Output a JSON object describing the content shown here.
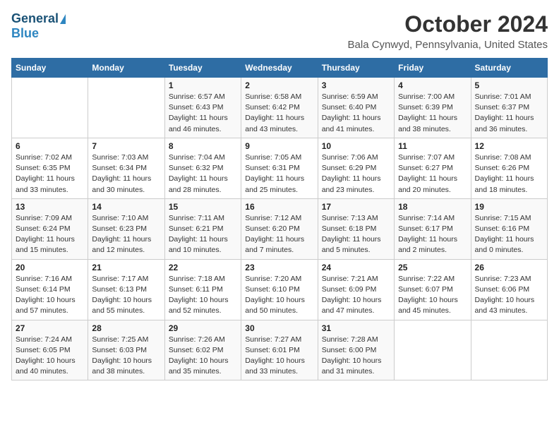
{
  "header": {
    "logo_general": "General",
    "logo_blue": "Blue",
    "month_title": "October 2024",
    "location": "Bala Cynwyd, Pennsylvania, United States"
  },
  "days_of_week": [
    "Sunday",
    "Monday",
    "Tuesday",
    "Wednesday",
    "Thursday",
    "Friday",
    "Saturday"
  ],
  "weeks": [
    [
      {
        "day": "",
        "info": ""
      },
      {
        "day": "",
        "info": ""
      },
      {
        "day": "1",
        "info": "Sunrise: 6:57 AM\nSunset: 6:43 PM\nDaylight: 11 hours and 46 minutes."
      },
      {
        "day": "2",
        "info": "Sunrise: 6:58 AM\nSunset: 6:42 PM\nDaylight: 11 hours and 43 minutes."
      },
      {
        "day": "3",
        "info": "Sunrise: 6:59 AM\nSunset: 6:40 PM\nDaylight: 11 hours and 41 minutes."
      },
      {
        "day": "4",
        "info": "Sunrise: 7:00 AM\nSunset: 6:39 PM\nDaylight: 11 hours and 38 minutes."
      },
      {
        "day": "5",
        "info": "Sunrise: 7:01 AM\nSunset: 6:37 PM\nDaylight: 11 hours and 36 minutes."
      }
    ],
    [
      {
        "day": "6",
        "info": "Sunrise: 7:02 AM\nSunset: 6:35 PM\nDaylight: 11 hours and 33 minutes."
      },
      {
        "day": "7",
        "info": "Sunrise: 7:03 AM\nSunset: 6:34 PM\nDaylight: 11 hours and 30 minutes."
      },
      {
        "day": "8",
        "info": "Sunrise: 7:04 AM\nSunset: 6:32 PM\nDaylight: 11 hours and 28 minutes."
      },
      {
        "day": "9",
        "info": "Sunrise: 7:05 AM\nSunset: 6:31 PM\nDaylight: 11 hours and 25 minutes."
      },
      {
        "day": "10",
        "info": "Sunrise: 7:06 AM\nSunset: 6:29 PM\nDaylight: 11 hours and 23 minutes."
      },
      {
        "day": "11",
        "info": "Sunrise: 7:07 AM\nSunset: 6:27 PM\nDaylight: 11 hours and 20 minutes."
      },
      {
        "day": "12",
        "info": "Sunrise: 7:08 AM\nSunset: 6:26 PM\nDaylight: 11 hours and 18 minutes."
      }
    ],
    [
      {
        "day": "13",
        "info": "Sunrise: 7:09 AM\nSunset: 6:24 PM\nDaylight: 11 hours and 15 minutes."
      },
      {
        "day": "14",
        "info": "Sunrise: 7:10 AM\nSunset: 6:23 PM\nDaylight: 11 hours and 12 minutes."
      },
      {
        "day": "15",
        "info": "Sunrise: 7:11 AM\nSunset: 6:21 PM\nDaylight: 11 hours and 10 minutes."
      },
      {
        "day": "16",
        "info": "Sunrise: 7:12 AM\nSunset: 6:20 PM\nDaylight: 11 hours and 7 minutes."
      },
      {
        "day": "17",
        "info": "Sunrise: 7:13 AM\nSunset: 6:18 PM\nDaylight: 11 hours and 5 minutes."
      },
      {
        "day": "18",
        "info": "Sunrise: 7:14 AM\nSunset: 6:17 PM\nDaylight: 11 hours and 2 minutes."
      },
      {
        "day": "19",
        "info": "Sunrise: 7:15 AM\nSunset: 6:16 PM\nDaylight: 11 hours and 0 minutes."
      }
    ],
    [
      {
        "day": "20",
        "info": "Sunrise: 7:16 AM\nSunset: 6:14 PM\nDaylight: 10 hours and 57 minutes."
      },
      {
        "day": "21",
        "info": "Sunrise: 7:17 AM\nSunset: 6:13 PM\nDaylight: 10 hours and 55 minutes."
      },
      {
        "day": "22",
        "info": "Sunrise: 7:18 AM\nSunset: 6:11 PM\nDaylight: 10 hours and 52 minutes."
      },
      {
        "day": "23",
        "info": "Sunrise: 7:20 AM\nSunset: 6:10 PM\nDaylight: 10 hours and 50 minutes."
      },
      {
        "day": "24",
        "info": "Sunrise: 7:21 AM\nSunset: 6:09 PM\nDaylight: 10 hours and 47 minutes."
      },
      {
        "day": "25",
        "info": "Sunrise: 7:22 AM\nSunset: 6:07 PM\nDaylight: 10 hours and 45 minutes."
      },
      {
        "day": "26",
        "info": "Sunrise: 7:23 AM\nSunset: 6:06 PM\nDaylight: 10 hours and 43 minutes."
      }
    ],
    [
      {
        "day": "27",
        "info": "Sunrise: 7:24 AM\nSunset: 6:05 PM\nDaylight: 10 hours and 40 minutes."
      },
      {
        "day": "28",
        "info": "Sunrise: 7:25 AM\nSunset: 6:03 PM\nDaylight: 10 hours and 38 minutes."
      },
      {
        "day": "29",
        "info": "Sunrise: 7:26 AM\nSunset: 6:02 PM\nDaylight: 10 hours and 35 minutes."
      },
      {
        "day": "30",
        "info": "Sunrise: 7:27 AM\nSunset: 6:01 PM\nDaylight: 10 hours and 33 minutes."
      },
      {
        "day": "31",
        "info": "Sunrise: 7:28 AM\nSunset: 6:00 PM\nDaylight: 10 hours and 31 minutes."
      },
      {
        "day": "",
        "info": ""
      },
      {
        "day": "",
        "info": ""
      }
    ]
  ]
}
